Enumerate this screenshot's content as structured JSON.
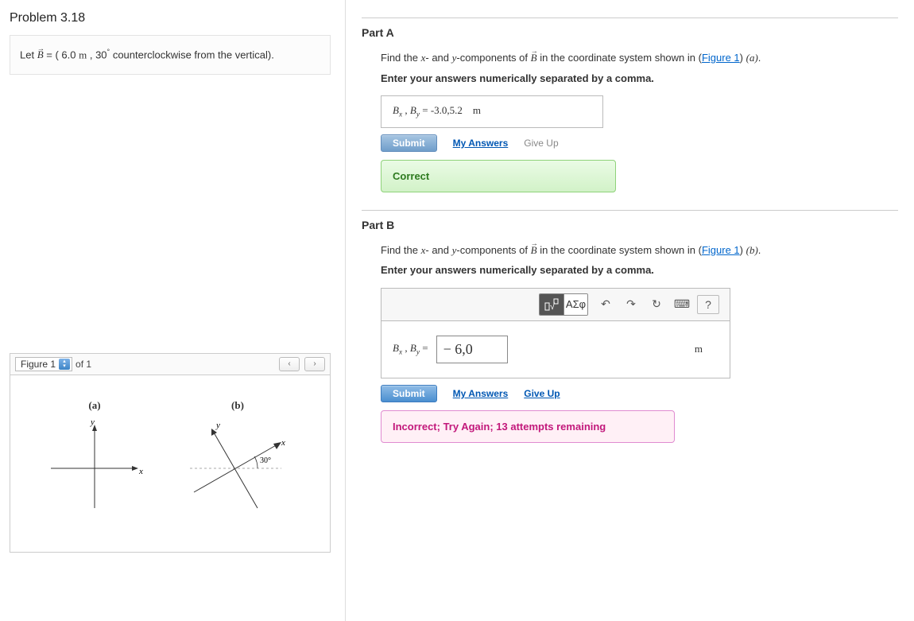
{
  "problem": {
    "title": "Problem 3.18",
    "let_text_prefix": "Let ",
    "vector": "B",
    "equals": " = ( 6.0 ",
    "unit_m": "m",
    "comma": ", ",
    "angle": "30",
    "degree": "°",
    "ccw": "  counterclockwise from the vertical)."
  },
  "figure": {
    "label": "Figure 1",
    "of_text": "of 1",
    "a_label": "(a)",
    "b_label": "(b)",
    "angle_b": "30°",
    "axis_x": "x",
    "axis_y": "y"
  },
  "parts": [
    {
      "heading": "Part A",
      "prompt_before": "Find the ",
      "var_x": "x",
      "middle1": "- and ",
      "var_y": "y",
      "middle2": "-components of ",
      "vector": "B",
      "after": " in the coordinate system shown in (",
      "figure_link": "Figure 1",
      "close": ") ",
      "sub_label": "(a)",
      "period": ".",
      "instruction": "Enter your answers numerically separated by a comma.",
      "lhs_bx": "B",
      "lhs_sub_x": "x",
      "lhs_sep": " , ",
      "lhs_by": "B",
      "lhs_sub_y": "y",
      "equals": " = ",
      "value": "-3.0,5.2",
      "unit": "m",
      "submit": "Submit",
      "my_answers": "My Answers",
      "give_up": "Give Up",
      "feedback": "Correct"
    },
    {
      "heading": "Part B",
      "prompt_before": "Find the ",
      "var_x": "x",
      "middle1": "- and ",
      "var_y": "y",
      "middle2": "-components of ",
      "vector": "B",
      "after": " in the coordinate system shown in (",
      "figure_link": "Figure 1",
      "close": ") ",
      "sub_label": "(b)",
      "period": ".",
      "instruction": "Enter your answers numerically separated by a comma.",
      "lhs_bx": "B",
      "lhs_sub_x": "x",
      "lhs_sep": " , ",
      "lhs_by": "B",
      "lhs_sub_y": "y",
      "equals": " = ",
      "value": "− 6,0",
      "unit": "m",
      "submit": "Submit",
      "my_answers": "My Answers",
      "give_up": "Give Up",
      "feedback": "Incorrect; Try Again; 13 attempts remaining",
      "toolbar": {
        "templates": "□√□",
        "symbols": "ΑΣφ",
        "undo": "↶",
        "redo": "↷",
        "reset": "↻",
        "keyboard": "⌨",
        "help": "?"
      }
    }
  ]
}
